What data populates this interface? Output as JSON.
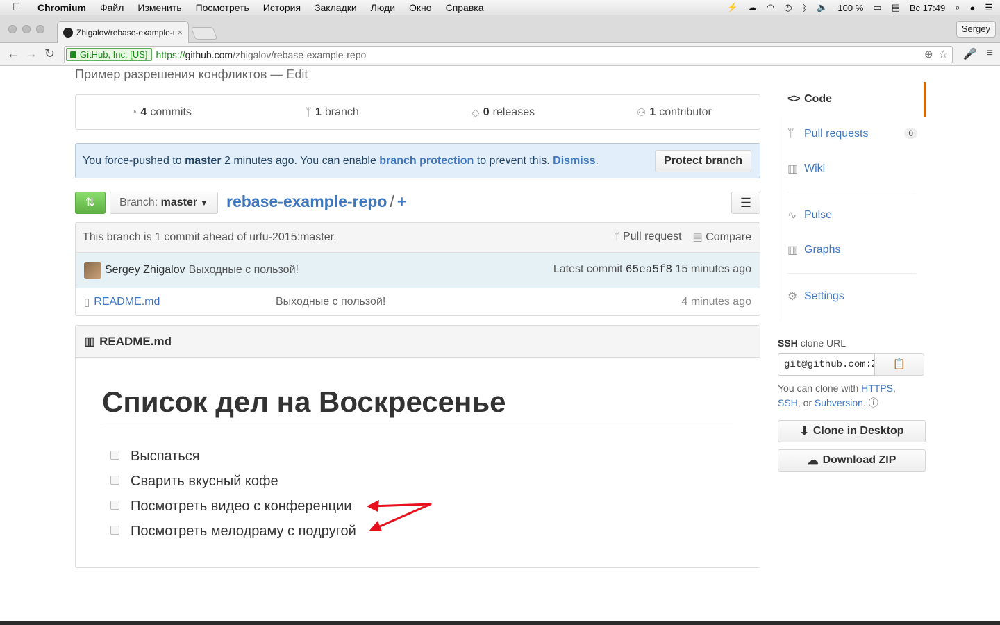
{
  "menubar": {
    "app": "Chromium",
    "items": [
      "Файл",
      "Изменить",
      "Посмотреть",
      "История",
      "Закладки",
      "Люди",
      "Окно",
      "Справка"
    ],
    "battery": "100 %",
    "clock": "Вс 17:49"
  },
  "tab": {
    "title": "Zhigalov/rebase-example-r",
    "close": "×"
  },
  "profile": "Sergey",
  "omnibox": {
    "ev": "GitHub, Inc. [US]",
    "scheme": "https://",
    "host": "github.com",
    "path": "/zhigalov/rebase-example-repo"
  },
  "repo": {
    "description": "Пример разрешения конфликтов",
    "edit": "— Edit",
    "summary": {
      "commits_count": "4",
      "commits_label": "commits",
      "branch_count": "1",
      "branch_label": "branch",
      "releases_count": "0",
      "releases_label": "releases",
      "contributor_count": "1",
      "contributor_label": "contributor"
    },
    "flash": {
      "t1": "You force-pushed to ",
      "branch": "master",
      "t2": " 2 minutes ago. You can enable ",
      "link": "branch protection",
      "t3": " to prevent this. ",
      "dismiss": "Dismiss",
      "t4": ".",
      "button": "Protect branch"
    },
    "branch_select": {
      "label": "Branch:",
      "value": "master"
    },
    "breadcrumb": {
      "repo": "rebase-example-repo",
      "sep": "/",
      "add": "+"
    },
    "ahead": {
      "text": "This branch is 1 commit ahead of urfu-2015:master.",
      "pull_request": "Pull request",
      "compare": "Compare"
    },
    "commit": {
      "author": "Sergey Zhigalov",
      "message": "Выходные с пользой!",
      "latest": "Latest commit",
      "sha": "65ea5f8",
      "age": "15 minutes ago"
    },
    "files": [
      {
        "name": "README.md",
        "message": "Выходные с пользой!",
        "age": "4 minutes ago"
      }
    ],
    "readme": {
      "header": "README.md",
      "title": "Список дел на Воскресенье",
      "tasks": [
        "Выспаться",
        "Сварить вкусный кофе",
        "Посмотреть видео с конференции",
        "Посмотреть мелодраму с подругой"
      ]
    }
  },
  "sidebar": {
    "code": "Code",
    "pull_requests": "Pull requests",
    "pull_requests_count": "0",
    "wiki": "Wiki",
    "pulse": "Pulse",
    "graphs": "Graphs",
    "settings": "Settings"
  },
  "clone": {
    "label_bold": "SSH",
    "label": "clone URL",
    "url": "git@github.com:Z",
    "help_prefix": "You can clone with ",
    "https": "HTTPS",
    "comma": ",",
    "ssh": "SSH",
    "or": ", or ",
    "svn": "Subversion",
    "dot": ".",
    "desktop": "Clone in Desktop",
    "zip": "Download ZIP"
  },
  "colors": {
    "accent": "#4078c0",
    "green": "#60b044",
    "selected_tab_bar": "#d26911",
    "annotation_arrow": "#e8101c"
  }
}
